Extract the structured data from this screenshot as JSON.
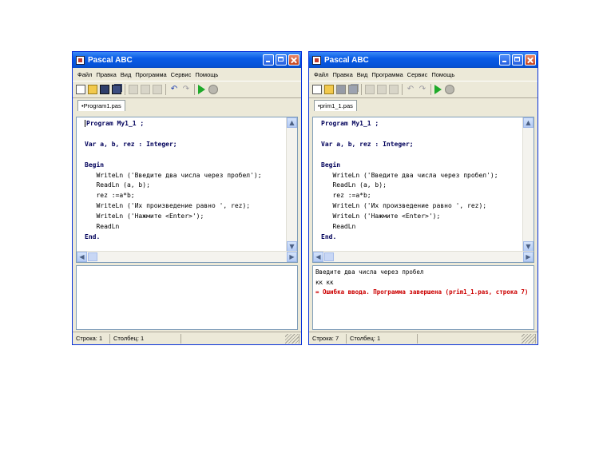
{
  "windows": [
    {
      "title": "Pascal ABC",
      "menu": [
        "Файл",
        "Правка",
        "Вид",
        "Программа",
        "Сервис",
        "Помощь"
      ],
      "tab": "•Program1.pas",
      "code": [
        "Program My1_1 ;",
        "",
        "Var a, b, rez : Integer;",
        "",
        "Begin",
        "   WriteLn ('Введите два числа через пробел');",
        "   ReadLn (a, b);",
        "   rez :=a*b;",
        "   WriteLn ('Их произведение равно ', rez);",
        "   WriteLn ('Нажмите <Enter>');",
        "   ReadLn",
        "End."
      ],
      "output": [
        "",
        "",
        ""
      ],
      "status": {
        "line": "Строка: 1",
        "col": "Столбец: 1"
      }
    },
    {
      "title": "Pascal ABC",
      "menu": [
        "Файл",
        "Правка",
        "Вид",
        "Программа",
        "Сервис",
        "Помощь"
      ],
      "tab": "•prim1_1.pas",
      "code": [
        "Program My1_1 ;",
        "",
        "Var a, b, rez : Integer;",
        "",
        "Begin",
        "   WriteLn ('Введите два числа через пробел');",
        "   ReadLn (a, b);",
        "   rez :=a*b;",
        "   WriteLn ('Их произведение равно ', rez);",
        "   WriteLn ('Нажмите <Enter>');",
        "   ReadLn",
        "End."
      ],
      "output": [
        "Введите два числа через пробел",
        "кк кк",
        "= Ошибка ввода. Программа завершена (prim1_1.pas, строка 7)"
      ],
      "status": {
        "line": "Строка: 7",
        "col": "Столбец: 1"
      }
    }
  ]
}
